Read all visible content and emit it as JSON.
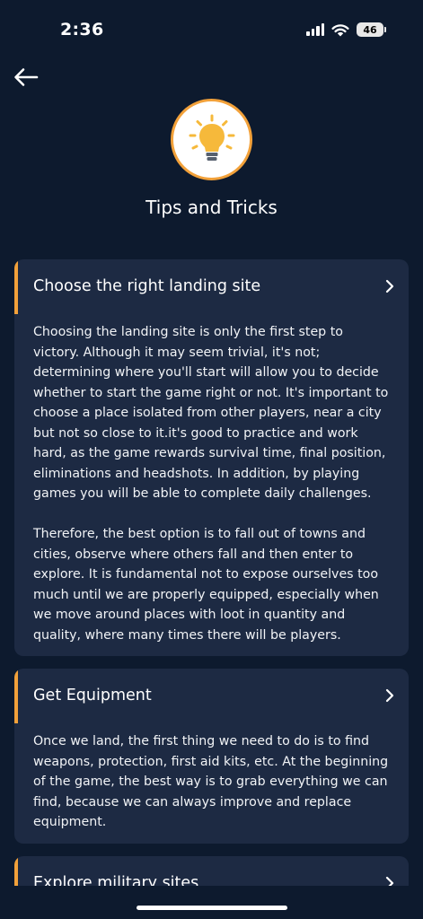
{
  "status_bar": {
    "time": "2:36",
    "battery": "46",
    "icons": [
      "signal-icon",
      "wifi-icon",
      "battery-icon"
    ]
  },
  "header": {
    "back_icon": "arrow-left-icon",
    "logo_icon": "lightbulb-icon",
    "title": "Tips and Tricks"
  },
  "colors": {
    "background": "#0d1a2e",
    "card": "#1d2a43",
    "accent": "#f2a13a",
    "bulb": "#f6b93b"
  },
  "tips": [
    {
      "title": "Choose the right landing site",
      "paragraphs": [
        "Choosing the landing site is only the first step to victory. Although it may seem trivial, it's not; determining where you'll start will allow you to decide whether to start the game right or not. It's important to choose a place isolated from other players, near a city but not so close to it.it's good to practice and work hard, as the game rewards survival time, final position, eliminations and headshots. In addition, by playing games you will be able to complete daily challenges.",
        "Therefore, the best option is to fall out of towns and cities, observe where others fall and then enter to explore. It is fundamental not to expose ourselves too much until we are properly equipped, especially when we move around places with loot in quantity and quality, where many times there will be players."
      ]
    },
    {
      "title": "Get Equipment",
      "paragraphs": [
        "Once we land, the first thing we need to do is to find weapons, protection, first aid kits, etc. At the beginning of the game, the best way is to grab everything we can find, because we can always improve and replace equipment."
      ]
    },
    {
      "title": "Explore military sites",
      "paragraphs": []
    }
  ]
}
